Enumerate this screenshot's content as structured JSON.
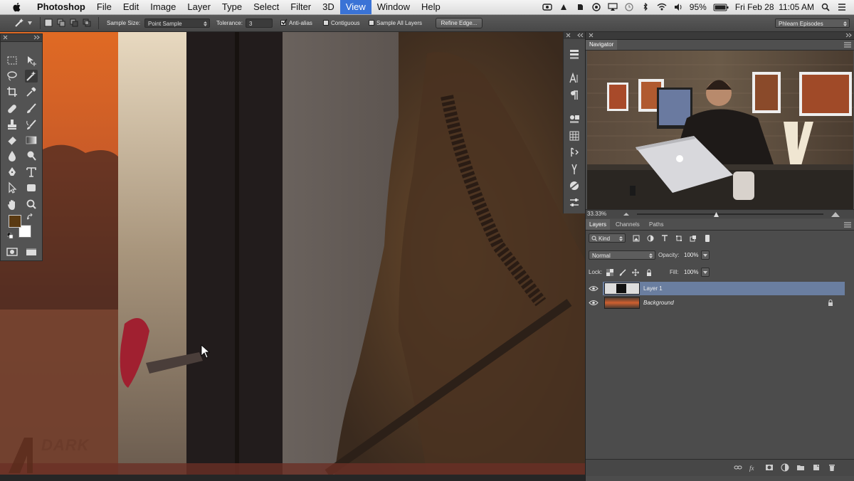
{
  "menubar": {
    "app_name": "Photoshop",
    "items": [
      "File",
      "Edit",
      "Image",
      "Layer",
      "Type",
      "Select",
      "Filter",
      "3D",
      "View",
      "Window",
      "Help"
    ],
    "active_item": "View",
    "battery": "95%",
    "datetime": "Fri Feb 28  11:05 AM"
  },
  "options": {
    "sample_size_label": "Sample Size:",
    "sample_size_value": "Point Sample",
    "tolerance_label": "Tolerance:",
    "tolerance_value": "3",
    "anti_alias_label": "Anti-alias",
    "anti_alias_checked": true,
    "contiguous_label": "Contiguous",
    "contiguous_checked": false,
    "sample_all_label": "Sample All Layers",
    "sample_all_checked": false,
    "refine_edge_label": "Refine Edge...",
    "workspace": "Phlearn Episodes"
  },
  "tools": {
    "foreground_color": "#5a3a12",
    "background_color": "#ffffff"
  },
  "navigator": {
    "tab_label": "Navigator",
    "zoom": "33.33%"
  },
  "layers_panel": {
    "tabs": [
      "Layers",
      "Channels",
      "Paths"
    ],
    "active_tab": "Layers",
    "filter_label": "Kind",
    "blend_mode": "Normal",
    "opacity_label": "Opacity:",
    "opacity_value": "100%",
    "lock_label": "Lock:",
    "fill_label": "Fill:",
    "fill_value": "100%",
    "layers": [
      {
        "name": "Layer 1",
        "selected": true,
        "visible": true
      },
      {
        "name": "Background",
        "selected": false,
        "visible": true,
        "locked": true
      }
    ]
  },
  "watermark": "DARK"
}
